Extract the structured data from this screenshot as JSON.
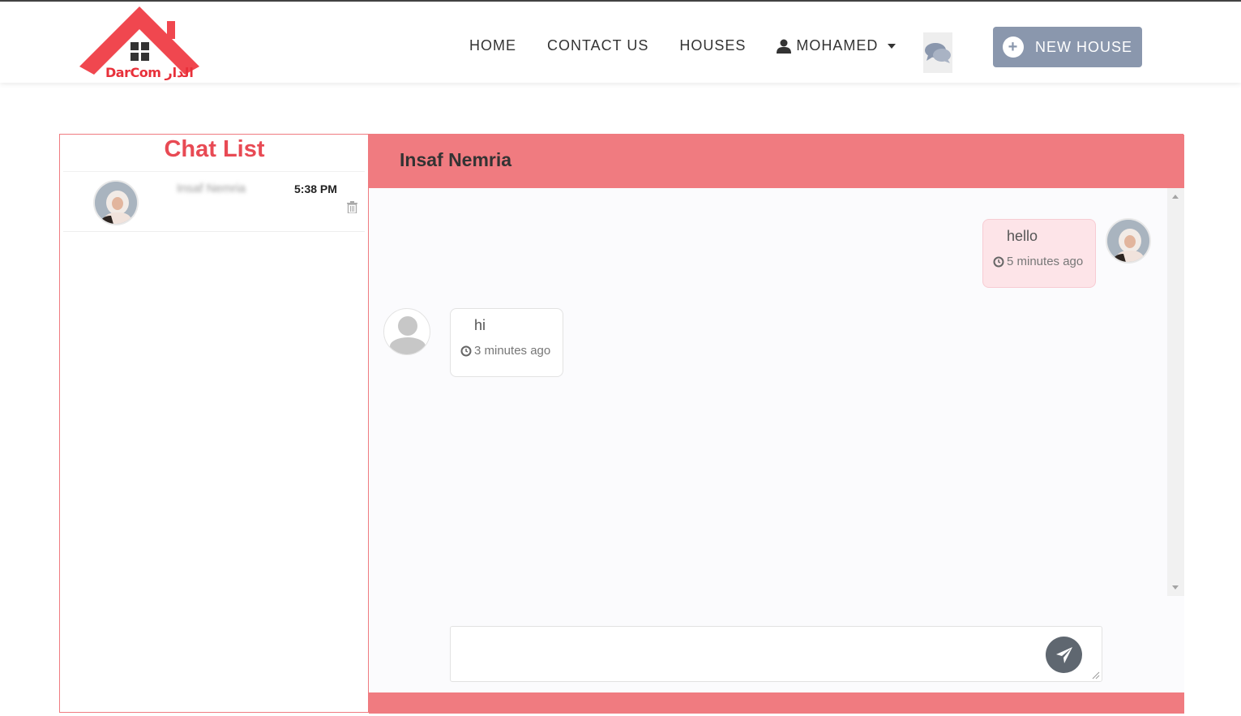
{
  "brand": {
    "logo_text": "DarCom الدار",
    "accent": "#e8303a"
  },
  "nav": {
    "home": "HOME",
    "contact": "CONTACT US",
    "houses": "HOUSES",
    "user": "MOHAMED",
    "new_house": "NEW HOUSE"
  },
  "chat_list": {
    "title": "Chat List",
    "items": [
      {
        "name": "Insaf Nemria",
        "time": "5:38 PM"
      }
    ]
  },
  "conversation": {
    "partner": "Insaf Nemria",
    "messages": [
      {
        "direction": "out",
        "text": "hello",
        "time": "5 minutes ago"
      },
      {
        "direction": "in",
        "text": "hi",
        "time": "3 minutes ago"
      }
    ],
    "compose_placeholder": ""
  },
  "colors": {
    "header": "#f07b80",
    "title": "#e84a54",
    "button": "#8a97ad",
    "bubble_out": "#fde4e8"
  }
}
